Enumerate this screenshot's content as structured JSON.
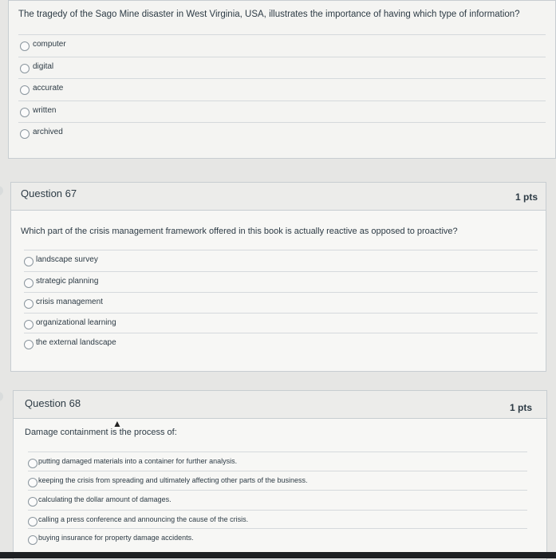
{
  "q_prev": {
    "text": "The tragedy of the Sago Mine disaster in West Virginia, USA, illustrates the importance of having which type of information?",
    "answers": [
      "computer",
      "digital",
      "accurate",
      "written",
      "archived"
    ]
  },
  "q67": {
    "title": "Question 67",
    "points": "1 pts",
    "text": "Which part of the crisis management framework offered in this book is actually reactive as opposed to proactive?",
    "answers": [
      "landscape survey",
      "strategic planning",
      "crisis management",
      "organizational learning",
      "the external landscape"
    ]
  },
  "q68": {
    "title": "Question 68",
    "points": "1 pts",
    "text": "Damage containment is the process of:",
    "answers": [
      "putting damaged materials into a container for further analysis.",
      "keeping the crisis from spreading and ultimately affecting other parts of the business.",
      "calculating the dollar amount of damages.",
      "calling a press conference and announcing the cause of the crisis.",
      "buying insurance for property damage accidents."
    ]
  }
}
